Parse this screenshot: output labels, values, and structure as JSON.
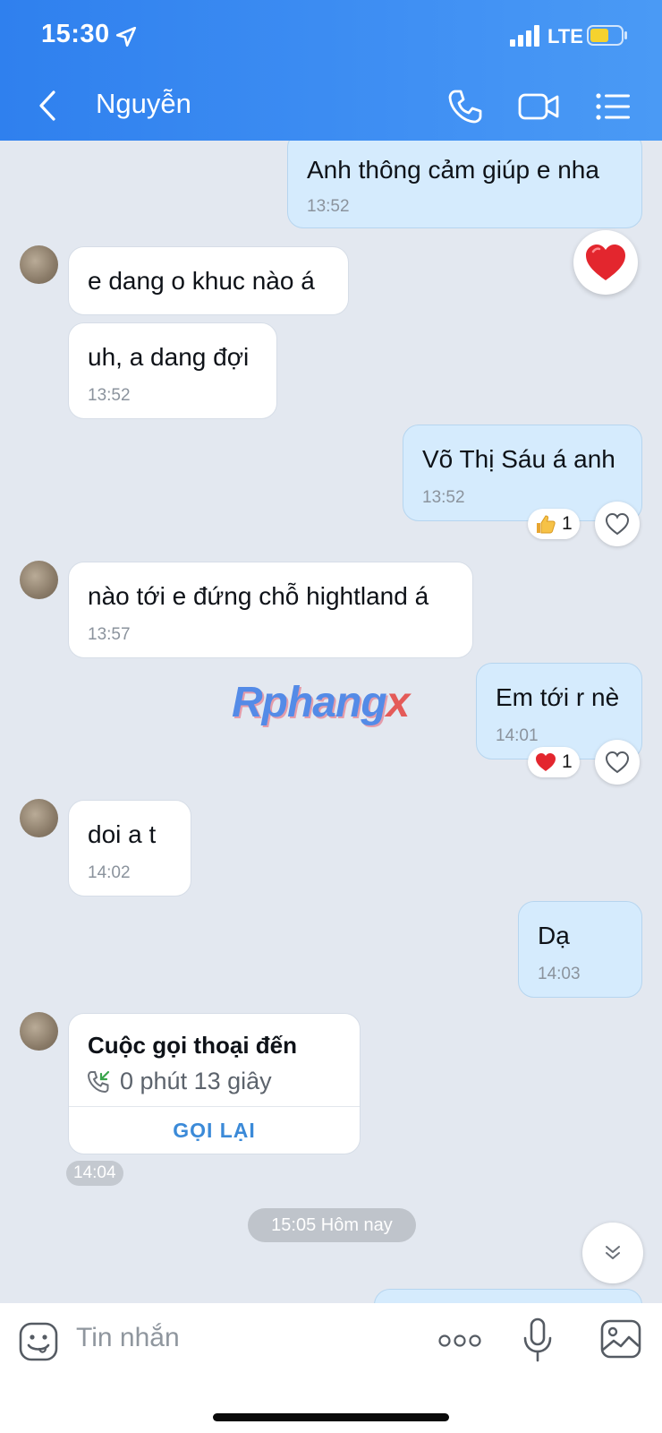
{
  "status_bar": {
    "time": "15:30",
    "network": "LTE",
    "icons": [
      "location-arrow-icon",
      "signal-bars-icon",
      "battery-icon"
    ]
  },
  "header": {
    "title": "Nguyễn",
    "icons": [
      "back-chevron-icon",
      "phone-icon",
      "video-call-icon",
      "menu-list-icon"
    ]
  },
  "messages": [
    {
      "direction": "out",
      "text": "Anh thông cảm giúp e nha",
      "time": "13:52",
      "reaction": "heart"
    },
    {
      "direction": "in",
      "text": "e dang o khuc nào á",
      "time": ""
    },
    {
      "direction": "in",
      "text": "uh, a dang đợi",
      "time": "13:52"
    },
    {
      "direction": "out",
      "text": "Võ Thị Sáu á anh",
      "time": "13:52",
      "reaction_count": "1",
      "reaction": "thumbs-up"
    },
    {
      "direction": "in",
      "text": "nào tới e đứng chỗ hightland á",
      "time": "13:57"
    },
    {
      "direction": "out",
      "text": "Em tới r nè",
      "time": "14:01",
      "reaction_count": "1",
      "reaction": "heart"
    },
    {
      "direction": "in",
      "text": "doi a t",
      "time": "14:02"
    },
    {
      "direction": "out",
      "text": "Dạ",
      "time": "14:03"
    }
  ],
  "call_card": {
    "title": "Cuộc gọi thoại đến",
    "duration": "0 phút 13 giây",
    "action": "GỌI LẠI",
    "time": "14:04"
  },
  "date_separator": "15:05 Hôm nay",
  "watermark": {
    "main": "Rphang",
    "accent": "x"
  },
  "input": {
    "placeholder": "Tin nhắn",
    "icons": [
      "sticker-icon",
      "more-dots-icon",
      "microphone-icon",
      "image-icon"
    ]
  },
  "colors": {
    "header_bg": "#2f80ee",
    "incoming_bubble": "#ffffff",
    "outgoing_bubble": "#d5ebfd",
    "chat_bg": "#e3e8f0",
    "action_blue": "#3b8ad8"
  }
}
